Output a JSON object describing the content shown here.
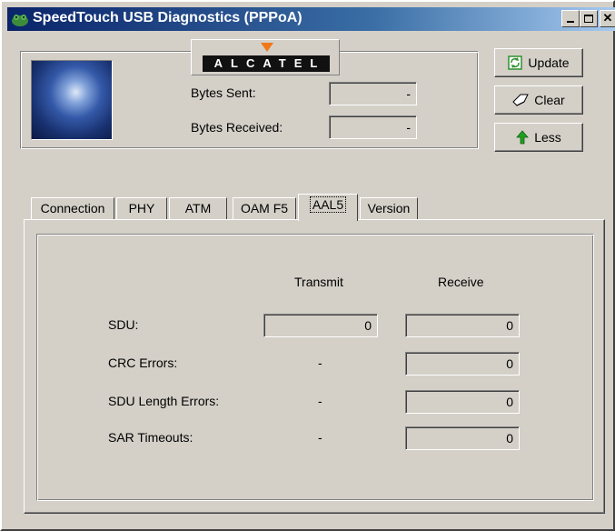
{
  "window": {
    "title": "SpeedTouch USB Diagnostics (PPPoA)",
    "min_icon": "minimize-icon",
    "max_icon": "maximize-icon",
    "close_icon": "close-icon"
  },
  "header": {
    "logo_text": "ALCATEL",
    "bytes_sent_label": "Bytes Sent:",
    "bytes_sent_value": "-",
    "bytes_received_label": "Bytes Received:",
    "bytes_received_value": "-"
  },
  "buttons": {
    "update": "Update",
    "clear": "Clear",
    "less": "Less"
  },
  "tabs": [
    {
      "label": "Connection"
    },
    {
      "label": "PHY"
    },
    {
      "label": "ATM"
    },
    {
      "label": "OAM F5"
    },
    {
      "label": "AAL5"
    },
    {
      "label": "Version"
    }
  ],
  "aal5": {
    "transmit_header": "Transmit",
    "receive_header": "Receive",
    "rows": [
      {
        "label": "SDU:",
        "transmit": "0",
        "receive": "0"
      },
      {
        "label": "CRC Errors:",
        "transmit": "-",
        "receive": "0"
      },
      {
        "label": "SDU Length Errors:",
        "transmit": "-",
        "receive": "0"
      },
      {
        "label": "SAR Timeouts:",
        "transmit": "-",
        "receive": "0"
      }
    ]
  },
  "colors": {
    "titlebar_start": "#0a246a",
    "titlebar_end": "#a6caf0",
    "face": "#d4d0c8",
    "logo_marker": "#f07818",
    "update_icon": "#2f8f2f",
    "less_arrow": "#20a020"
  }
}
